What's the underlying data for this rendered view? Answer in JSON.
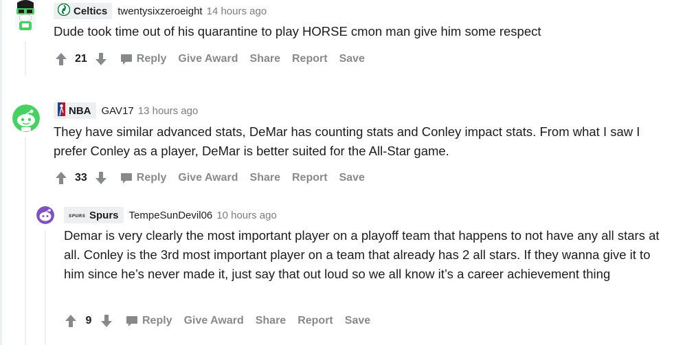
{
  "comments": [
    {
      "flair": "Celtics",
      "username": "twentysixzeroeight",
      "time": "14 hours ago",
      "body": "Dude took time out of his quarantine to play HORSE cmon man give him some respect",
      "score": "21",
      "avatar_color": "#46d160",
      "flair_icon": "celtics-logo-icon"
    },
    {
      "flair": "NBA",
      "username": "GAV17",
      "time": "13 hours ago",
      "body": "They have similar advanced stats, DeMar has counting stats and Conley impact stats. From what I saw I prefer Conley as a player, DeMar is better suited for the All-Star game.",
      "score": "33",
      "avatar_color": "#46d160",
      "flair_icon": "nba-logo-icon"
    },
    {
      "flair": "Spurs",
      "username": "TempeSunDevil06",
      "time": "10 hours ago",
      "body": "Demar is very clearly the most important player on a playoff team that happens to not have any all stars at all. Conley is the 3rd most important player on a team that already has 2 all stars. If they wanna give it to him since he’s never made it, just say that out loud so we all know it’s a career achievement thing",
      "score": "9",
      "avatar_color": "#7e53c1",
      "flair_icon": "spurs-logo-icon",
      "flair_logo_text": "SPURS"
    }
  ],
  "actions": {
    "reply": "Reply",
    "give_award": "Give Award",
    "share": "Share",
    "report": "Report",
    "save": "Save"
  }
}
